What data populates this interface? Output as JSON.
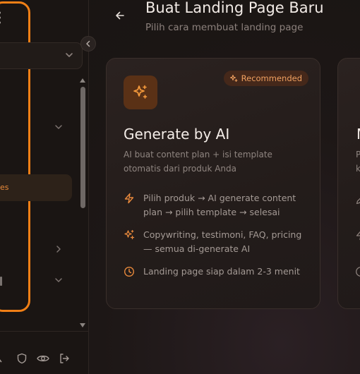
{
  "sidebar": {
    "active_label": "es"
  },
  "header": {
    "title": "Buat Landing Page Baru",
    "subtitle": "Pilih cara membuat landing page"
  },
  "cards": [
    {
      "title": "Generate by AI",
      "badge": "Recommended",
      "description": "AI buat content plan + isi template otomatis dari produk Anda",
      "features": [
        {
          "icon": "zap-icon",
          "text": "Pilih produk → AI generate content plan → pilih template → selesai"
        },
        {
          "icon": "sparkles-icon",
          "text": "Copywriting, testimoni, FAQ, pricing — semua di-generate AI"
        },
        {
          "icon": "clock-icon",
          "text": "Landing page siap dalam 2-3 menit"
        }
      ]
    },
    {
      "title": "M",
      "description_lines": [
        "P",
        "k"
      ]
    }
  ],
  "colors": {
    "accent": "#f07f16",
    "background": "#1b1614",
    "card": "#2b2220",
    "title_text": "#f2ebe6",
    "muted_text": "#8c817c"
  }
}
